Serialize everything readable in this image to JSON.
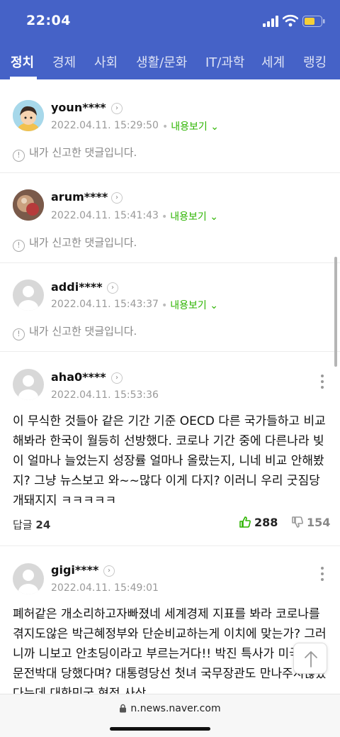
{
  "status_bar": {
    "time": "22:04"
  },
  "tabs": [
    {
      "label": "정치",
      "active": true
    },
    {
      "label": "경제"
    },
    {
      "label": "사회"
    },
    {
      "label": "생활/문화"
    },
    {
      "label": "IT/과학"
    },
    {
      "label": "세계"
    },
    {
      "label": "랭킹"
    }
  ],
  "comments": [
    {
      "username": "youn****",
      "date": "2022.04.11. 15:29:50",
      "more_label": "내용보기",
      "notice": "내가 신고한 댓글입니다."
    },
    {
      "username": "arum****",
      "date": "2022.04.11. 15:41:43",
      "more_label": "내용보기",
      "notice": "내가 신고한 댓글입니다."
    },
    {
      "username": "addi****",
      "date": "2022.04.11. 15:43:37",
      "more_label": "내용보기",
      "notice": "내가 신고한 댓글입니다."
    },
    {
      "username": "aha0****",
      "date": "2022.04.11. 15:53:36",
      "text": "이 무식한 것들아 같은 기간 기준 OECD 다른 국가들하고 비교해봐라 한국이 월등히 선방했다. 코로나 기간 중에 다른나라 빚이 얼마나 늘었는지 성장률 얼마나 올랐는지, 니네 비교 안해봤지? 그냥 뉴스보고 와~~많다 이게 다지? 이러니 우리 굿짐당 개돼지지 ㅋㅋㅋㅋㅋ",
      "replies_label": "답글",
      "replies": "24",
      "likes": "288",
      "dislikes": "154"
    },
    {
      "username": "gigi****",
      "date": "2022.04.11. 15:49:01",
      "text": "폐허같은 개소리하고자빠졌네 세계경제 지표를 봐라 코로나를 겪지도않은 박근혜정부와 단순비교하는게 이치에 맞는가? 그러니까 니보고 안초딩이라고 부르는거다!! 박진 특사가 미국에서 문전박대 당했다며? 대통령당선 첫녀 국무장관도 만나주지않았다는데 대한민국 현정 사상"
    }
  ],
  "url_bar": {
    "domain": "n.news.naver.com"
  }
}
